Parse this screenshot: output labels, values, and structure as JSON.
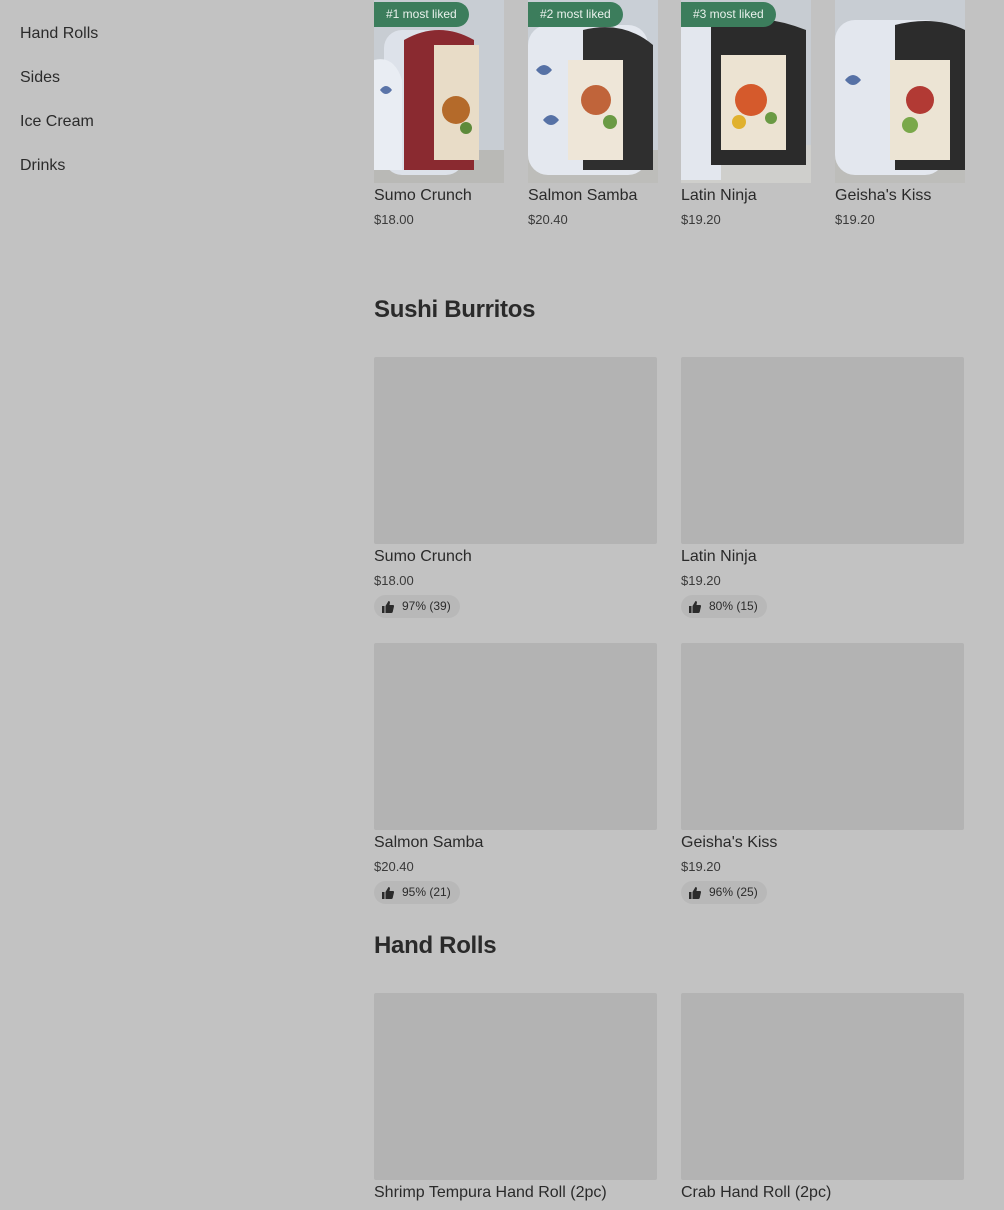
{
  "sidebar": {
    "items": [
      {
        "label": "Hand Rolls"
      },
      {
        "label": "Sides"
      },
      {
        "label": "Ice Cream"
      },
      {
        "label": "Drinks"
      }
    ]
  },
  "featured": {
    "items": [
      {
        "badge": "#1 most liked",
        "name": "Sumo Crunch",
        "price": "$18.00"
      },
      {
        "badge": "#2 most liked",
        "name": "Salmon Samba",
        "price": "$20.40"
      },
      {
        "badge": "#3 most liked",
        "name": "Latin Ninja",
        "price": "$19.20"
      },
      {
        "badge": "",
        "name": "Geisha's Kiss",
        "price": "$19.20"
      }
    ]
  },
  "sections": {
    "sushi_burritos": {
      "title": "Sushi Burritos",
      "items": [
        {
          "name": "Sumo Crunch",
          "price": "$18.00",
          "rating": "97% (39)"
        },
        {
          "name": "Latin Ninja",
          "price": "$19.20",
          "rating": "80% (15)"
        },
        {
          "name": "Salmon Samba",
          "price": "$20.40",
          "rating": "95% (21)"
        },
        {
          "name": "Geisha's Kiss",
          "price": "$19.20",
          "rating": "96% (25)"
        }
      ]
    },
    "hand_rolls": {
      "title": "Hand Rolls",
      "items": [
        {
          "name": "Shrimp Tempura Hand Roll (2pc)"
        },
        {
          "name": "Crab Hand Roll (2pc)"
        }
      ]
    }
  },
  "colors": {
    "overlay_bg": "#c2c2c2",
    "badge_bg": "#3c7d5c",
    "placeholder": "#b3b3b3"
  },
  "icons": {
    "rating": "thumbs-up-icon"
  }
}
